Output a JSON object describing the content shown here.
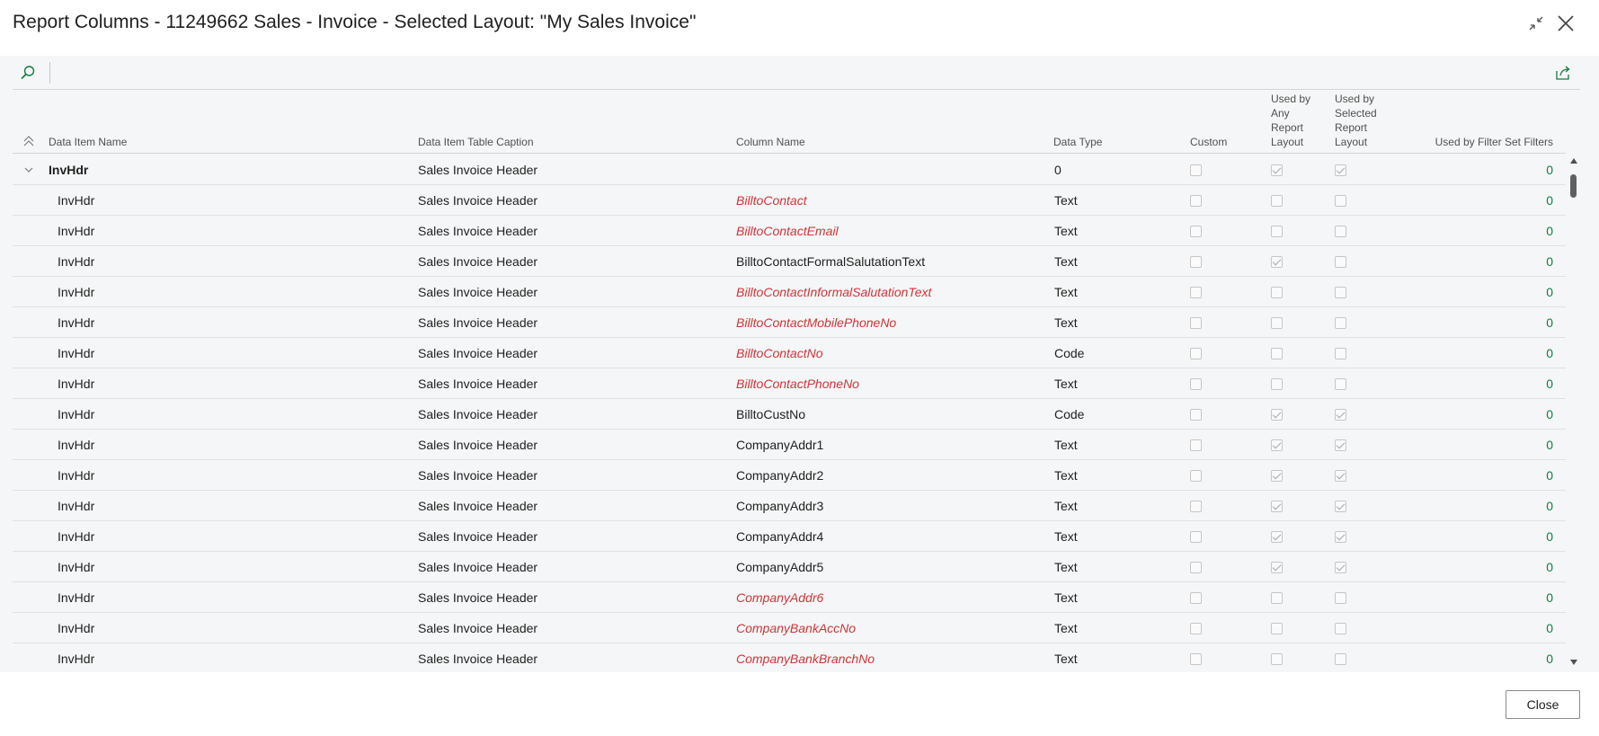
{
  "window": {
    "title": "Report Columns - 11249662 Sales - Invoice - Selected Layout: \"My Sales Invoice\""
  },
  "colors": {
    "accent": "#107c41",
    "not_used_column_text": "#d13438",
    "grid_background": "#f5f6f7"
  },
  "icons": {
    "search": "search-icon",
    "share": "share-icon",
    "collapse_window": "collapse-icon",
    "close_window": "close-icon",
    "collapse_all": "collapse-all-icon",
    "row_expander": "chevron-down-icon"
  },
  "grid": {
    "headers": {
      "data_item_name": "Data Item Name",
      "table_caption": "Data Item Table Caption",
      "column_name": "Column Name",
      "data_type": "Data Type",
      "custom": "Custom",
      "used_by_any": "Used by Any Report Layout",
      "used_by_selected": "Used by Selected Report Layout",
      "used_by_filter": "Used by Filter Set Filters"
    },
    "rows": [
      {
        "group": true,
        "name": "InvHdr",
        "caption": "Sales Invoice Header",
        "column": "",
        "not_used": false,
        "type": "0",
        "custom": false,
        "any": true,
        "selected": true,
        "filter": "0"
      },
      {
        "group": false,
        "name": "InvHdr",
        "caption": "Sales Invoice Header",
        "column": "BilltoContact",
        "not_used": true,
        "type": "Text",
        "custom": false,
        "any": false,
        "selected": false,
        "filter": "0"
      },
      {
        "group": false,
        "name": "InvHdr",
        "caption": "Sales Invoice Header",
        "column": "BilltoContactEmail",
        "not_used": true,
        "type": "Text",
        "custom": false,
        "any": false,
        "selected": false,
        "filter": "0"
      },
      {
        "group": false,
        "name": "InvHdr",
        "caption": "Sales Invoice Header",
        "column": "BilltoContactFormalSalutationText",
        "not_used": false,
        "type": "Text",
        "custom": false,
        "any": true,
        "selected": false,
        "filter": "0"
      },
      {
        "group": false,
        "name": "InvHdr",
        "caption": "Sales Invoice Header",
        "column": "BilltoContactInformalSalutationText",
        "not_used": true,
        "type": "Text",
        "custom": false,
        "any": false,
        "selected": false,
        "filter": "0"
      },
      {
        "group": false,
        "name": "InvHdr",
        "caption": "Sales Invoice Header",
        "column": "BilltoContactMobilePhoneNo",
        "not_used": true,
        "type": "Text",
        "custom": false,
        "any": false,
        "selected": false,
        "filter": "0"
      },
      {
        "group": false,
        "name": "InvHdr",
        "caption": "Sales Invoice Header",
        "column": "BilltoContactNo",
        "not_used": true,
        "type": "Code",
        "custom": false,
        "any": false,
        "selected": false,
        "filter": "0"
      },
      {
        "group": false,
        "name": "InvHdr",
        "caption": "Sales Invoice Header",
        "column": "BilltoContactPhoneNo",
        "not_used": true,
        "type": "Text",
        "custom": false,
        "any": false,
        "selected": false,
        "filter": "0"
      },
      {
        "group": false,
        "name": "InvHdr",
        "caption": "Sales Invoice Header",
        "column": "BilltoCustNo",
        "not_used": false,
        "type": "Code",
        "custom": false,
        "any": true,
        "selected": true,
        "filter": "0"
      },
      {
        "group": false,
        "name": "InvHdr",
        "caption": "Sales Invoice Header",
        "column": "CompanyAddr1",
        "not_used": false,
        "type": "Text",
        "custom": false,
        "any": true,
        "selected": true,
        "filter": "0"
      },
      {
        "group": false,
        "name": "InvHdr",
        "caption": "Sales Invoice Header",
        "column": "CompanyAddr2",
        "not_used": false,
        "type": "Text",
        "custom": false,
        "any": true,
        "selected": true,
        "filter": "0"
      },
      {
        "group": false,
        "name": "InvHdr",
        "caption": "Sales Invoice Header",
        "column": "CompanyAddr3",
        "not_used": false,
        "type": "Text",
        "custom": false,
        "any": true,
        "selected": true,
        "filter": "0"
      },
      {
        "group": false,
        "name": "InvHdr",
        "caption": "Sales Invoice Header",
        "column": "CompanyAddr4",
        "not_used": false,
        "type": "Text",
        "custom": false,
        "any": true,
        "selected": true,
        "filter": "0"
      },
      {
        "group": false,
        "name": "InvHdr",
        "caption": "Sales Invoice Header",
        "column": "CompanyAddr5",
        "not_used": false,
        "type": "Text",
        "custom": false,
        "any": true,
        "selected": true,
        "filter": "0"
      },
      {
        "group": false,
        "name": "InvHdr",
        "caption": "Sales Invoice Header",
        "column": "CompanyAddr6",
        "not_used": true,
        "type": "Text",
        "custom": false,
        "any": false,
        "selected": false,
        "filter": "0"
      },
      {
        "group": false,
        "name": "InvHdr",
        "caption": "Sales Invoice Header",
        "column": "CompanyBankAccNo",
        "not_used": true,
        "type": "Text",
        "custom": false,
        "any": false,
        "selected": false,
        "filter": "0"
      },
      {
        "group": false,
        "name": "InvHdr",
        "caption": "Sales Invoice Header",
        "column": "CompanyBankBranchNo",
        "not_used": true,
        "type": "Text",
        "custom": false,
        "any": false,
        "selected": false,
        "filter": "0"
      }
    ]
  },
  "footer": {
    "close_label": "Close"
  }
}
